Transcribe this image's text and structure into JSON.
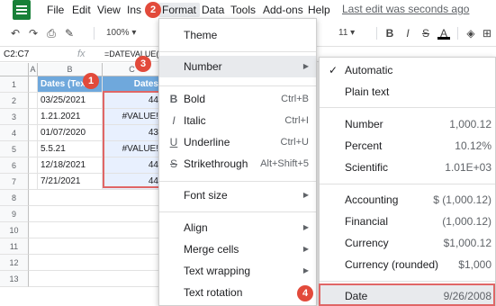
{
  "menubar": {
    "items": [
      "File",
      "Edit",
      "View",
      "Ins",
      "Format",
      "Data",
      "Tools",
      "Add-ons",
      "Help"
    ],
    "last_edit": "Last edit was seconds ago"
  },
  "toolbar": {
    "zoom": "100%",
    "font_size": "11",
    "bold": "B",
    "italic": "I",
    "strike": "S",
    "text_color": "A"
  },
  "formula_bar": {
    "name_box": "C2:C7",
    "fx": "fx",
    "formula": "=DATEVALUE("
  },
  "sheet": {
    "columns": [
      "A",
      "B",
      "C"
    ],
    "rows": [
      "1",
      "2",
      "3",
      "4",
      "5",
      "6",
      "7",
      "8",
      "9",
      "10",
      "11",
      "12",
      "13"
    ],
    "header": [
      "Dates (Text)",
      "Dates"
    ],
    "data": [
      [
        "03/25/2021",
        "44"
      ],
      [
        "1.21.2021",
        "#VALUE!"
      ],
      [
        "01/07/2020",
        "43"
      ],
      [
        "5.5.21",
        "#VALUE!"
      ],
      [
        "12/18/2021",
        "44"
      ],
      [
        "7/21/2021",
        "44"
      ]
    ]
  },
  "badges": [
    "1",
    "2",
    "3",
    "4"
  ],
  "format_menu": {
    "theme": "Theme",
    "number": "Number",
    "bold": {
      "label": "Bold",
      "shortcut": "Ctrl+B",
      "icon": "B"
    },
    "italic": {
      "label": "Italic",
      "shortcut": "Ctrl+I",
      "icon": "I"
    },
    "underline": {
      "label": "Underline",
      "shortcut": "Ctrl+U",
      "icon": "U"
    },
    "strikethrough": {
      "label": "Strikethrough",
      "shortcut": "Alt+Shift+5",
      "icon": "S"
    },
    "font_size": "Font size",
    "align": "Align",
    "merge_cells": "Merge cells",
    "text_wrapping": "Text wrapping",
    "text_rotation": "Text rotation"
  },
  "number_menu": {
    "automatic": "Automatic",
    "plain_text": "Plain text",
    "number": {
      "label": "Number",
      "example": "1,000.12"
    },
    "percent": {
      "label": "Percent",
      "example": "10.12%"
    },
    "scientific": {
      "label": "Scientific",
      "example": "1.01E+03"
    },
    "accounting": {
      "label": "Accounting",
      "example": "$ (1,000.12)"
    },
    "financial": {
      "label": "Financial",
      "example": "(1,000.12)"
    },
    "currency": {
      "label": "Currency",
      "example": "$1,000.12"
    },
    "currency_rounded": {
      "label": "Currency (rounded)",
      "example": "$1,000"
    },
    "date": {
      "label": "Date",
      "example": "9/26/2008"
    }
  },
  "colors": {
    "header_fill": "#6fa8dc",
    "selection_fill": "#e8f0fe",
    "highlight_red": "#e06666",
    "badge_red": "#e24a3b",
    "sheets_green": "#188038"
  }
}
